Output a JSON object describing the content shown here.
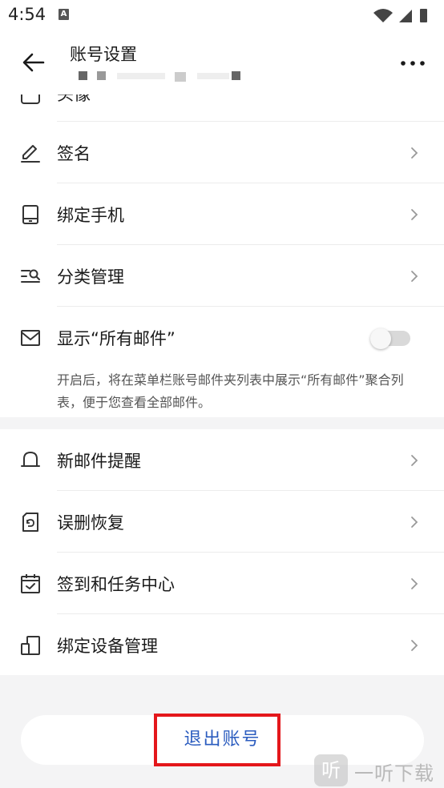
{
  "status_bar": {
    "time": "4:54",
    "notification_badge": "A"
  },
  "app_bar": {
    "title": "账号设置"
  },
  "partial_row": {
    "label": "头像"
  },
  "settings_group_1": [
    {
      "label": "签名",
      "icon": "pen-icon"
    },
    {
      "label": "绑定手机",
      "icon": "phone-icon"
    },
    {
      "label": "分类管理",
      "icon": "category-search-icon"
    }
  ],
  "show_all_mail": {
    "label": "显示“所有邮件”",
    "enabled": false,
    "hint": "开启后，将在菜单栏账号邮件夹列表中展示“所有邮件”聚合列表，便于您查看全部邮件。"
  },
  "settings_group_2": [
    {
      "label": "新邮件提醒",
      "icon": "bell-icon"
    },
    {
      "label": "误删恢复",
      "icon": "restore-icon"
    },
    {
      "label": "签到和任务中心",
      "icon": "calendar-check-icon"
    },
    {
      "label": "绑定设备管理",
      "icon": "devices-icon"
    }
  ],
  "logout": {
    "label": "退出账号"
  },
  "watermark": {
    "logo": "听",
    "text": "一听下载"
  },
  "colors": {
    "accent": "#2b5cbf",
    "highlight": "#e4171b",
    "background": "#f4f4f5"
  }
}
